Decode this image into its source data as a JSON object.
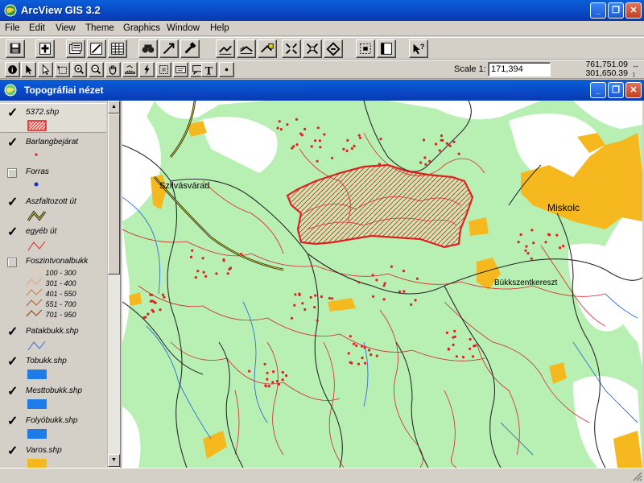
{
  "app": {
    "title": "ArcView GIS 3.2"
  },
  "menu": [
    "File",
    "Edit",
    "View",
    "Theme",
    "Graphics",
    "Window",
    "Help"
  ],
  "scale": {
    "label": "Scale 1:",
    "value": "171,394"
  },
  "coords": {
    "x": "761,751.09",
    "y": "301,650.39"
  },
  "view": {
    "title": "Topográfiai nézet"
  },
  "themes": [
    {
      "name": "5372.shp",
      "checked": true
    },
    {
      "name": "Barlangbejárat",
      "checked": true
    },
    {
      "name": "Forras",
      "checked": false
    },
    {
      "name": "Aszfaltozott út",
      "checked": true
    },
    {
      "name": "egyéb út",
      "checked": true
    },
    {
      "name": "Foszintvonalbukk",
      "checked": false,
      "legend": [
        "100 - 300",
        "301 - 400",
        "401 - 550",
        "551 - 700",
        "701 - 950"
      ]
    },
    {
      "name": "Patakbukk.shp",
      "checked": true
    },
    {
      "name": "Tobukk.shp",
      "checked": true
    },
    {
      "name": "Mesttobukk.shp",
      "checked": true
    },
    {
      "name": "Folyóbukk.shp",
      "checked": true
    },
    {
      "name": "Varos.shp",
      "checked": true
    }
  ],
  "map_labels": {
    "city1": "Szilvásvárad",
    "city2": "Miskolc",
    "town": "Bükkszentkereszt"
  },
  "colors": {
    "forest": "#b8f0b4",
    "town": "#f5b91f",
    "contour": "#d8232a",
    "stream": "#2f6fd6",
    "road": "#2a2a2a",
    "selection": "#e02020"
  }
}
